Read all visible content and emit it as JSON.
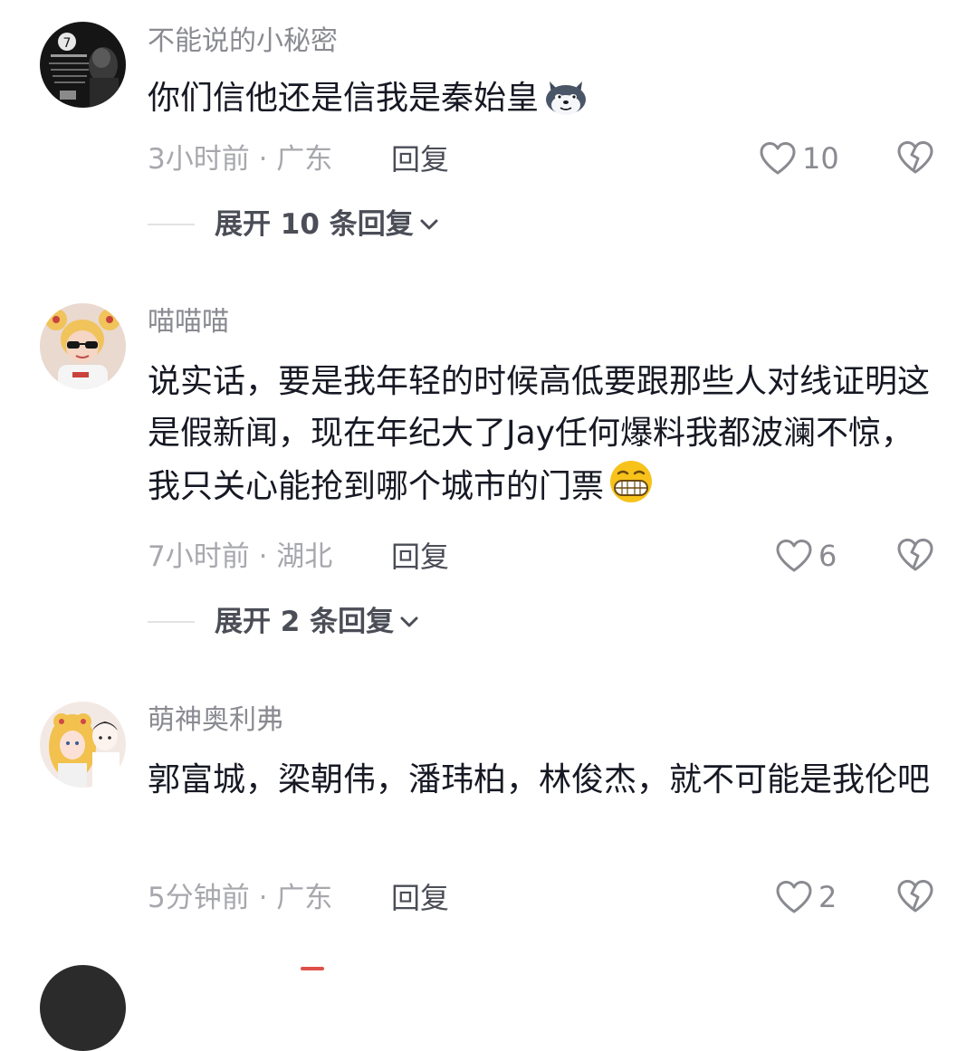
{
  "comments": [
    {
      "username": "不能说的小秘密",
      "text": "你们信他还是信我是秦始皇",
      "emoji": "husky-dog-emoji",
      "time_location": "3小时前 · 广东",
      "reply_label": "回复",
      "like_count": "10",
      "expand_label": "展开 10 条回复"
    },
    {
      "username": "喵喵喵",
      "text": "说实话，要是我年轻的时候高低要跟那些人对线证明这是假新闻，现在年纪大了Jay任何爆料我都波澜不惊，我只关心能抢到哪个城市的门票",
      "emoji": "grinning-face-emoji",
      "time_location": "7小时前 · 湖北",
      "reply_label": "回复",
      "like_count": "6",
      "expand_label": "展开 2 条回复"
    },
    {
      "username": "萌神奥利弗",
      "text": "郭富城，梁朝伟，潘玮柏，林俊杰，就不可能是我伦吧",
      "time_location": "5分钟前 · 广东",
      "reply_label": "回复",
      "like_count": "2"
    }
  ],
  "icons": {
    "like": "heart-outline-icon",
    "dislike": "broken-heart-icon",
    "expand": "chevron-down-icon"
  },
  "colors": {
    "text": "#161823",
    "muted": "#8a8b91",
    "meta": "#a7a8ad",
    "action": "#4b4d57"
  }
}
